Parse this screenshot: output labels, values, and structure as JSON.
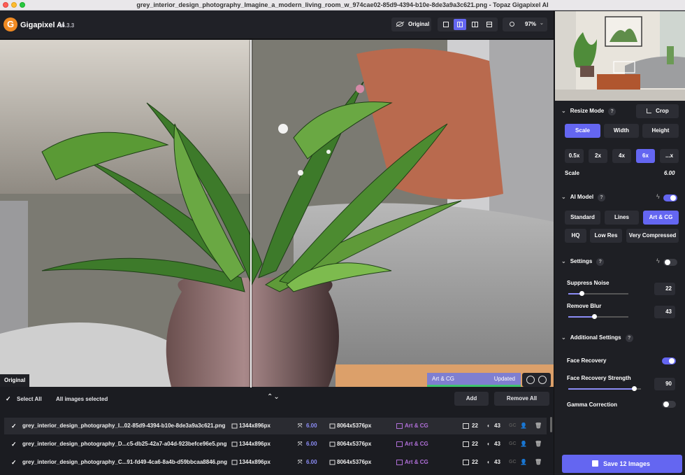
{
  "window": {
    "title": "grey_interior_design_photography_Imagine_a_modern_living_room_w_974cae02-85d9-4394-b10e-8de3a9a3c621.png - Topaz Gigapixel AI"
  },
  "toolbar": {
    "logo_letter": "G",
    "app_name": "Gigapixel AI",
    "version": "v6.3.3",
    "original_label": "Original",
    "zoom": "97%"
  },
  "preview": {
    "original_tag": "Original",
    "model_tag": "Art & CG",
    "status_tag": "Updated"
  },
  "file_list": {
    "select_all": "Select All",
    "selection_info": "All images selected",
    "add": "Add",
    "remove_all": "Remove All",
    "rows": [
      {
        "name": "grey_interior_design_photography_I...02-85d9-4394-b10e-8de3a9a3c621.png",
        "input_size": "1344x896px",
        "scale": "6.00",
        "output_size": "8064x5376px",
        "model": "Art & CG",
        "noise": "22",
        "blur": "43",
        "gc": "GC"
      },
      {
        "name": "grey_interior_design_photography_D...c5-db25-42a7-a04d-923befce96e5.png",
        "input_size": "1344x896px",
        "scale": "6.00",
        "output_size": "8064x5376px",
        "model": "Art & CG",
        "noise": "22",
        "blur": "43",
        "gc": "GC"
      },
      {
        "name": "grey_interior_design_photography_C...91-fd49-4ca6-8a4b-d59bbcaa8846.png",
        "input_size": "1344x896px",
        "scale": "6.00",
        "output_size": "8064x5376px",
        "model": "Art & CG",
        "noise": "22",
        "blur": "43",
        "gc": "GC"
      }
    ]
  },
  "panel": {
    "resize_mode": {
      "title": "Resize Mode",
      "crop": "Crop",
      "modes": [
        "Scale",
        "Width",
        "Height"
      ],
      "active_mode": "Scale",
      "presets": [
        "0.5x",
        "2x",
        "4x",
        "6x",
        "...x"
      ],
      "active_preset": "6x",
      "scale_label": "Scale",
      "scale_value": "6.00"
    },
    "ai_model": {
      "title": "AI Model",
      "models_row1": [
        "Standard",
        "Lines",
        "Art & CG"
      ],
      "models_row2": [
        "HQ",
        "Low Res",
        "Very Compressed"
      ],
      "active": "Art & CG"
    },
    "settings": {
      "title": "Settings",
      "suppress_noise_label": "Suppress Noise",
      "suppress_noise": "22",
      "suppress_noise_level": 0.22,
      "remove_blur_label": "Remove Blur",
      "remove_blur": "43",
      "remove_blur_level": 0.43
    },
    "additional": {
      "title": "Additional Settings",
      "face_recovery_label": "Face Recovery",
      "face_recovery_on": true,
      "face_strength_label": "Face Recovery Strength",
      "face_strength": "90",
      "face_strength_level": 0.9,
      "gamma_label": "Gamma Correction",
      "gamma_on": false
    },
    "save": "Save 12 Images"
  },
  "colors": {
    "accent": "#6466f1",
    "scale_text": "#8b8cf5",
    "model_text": "#b06fd8",
    "updated_bar": "#3ec46d"
  }
}
